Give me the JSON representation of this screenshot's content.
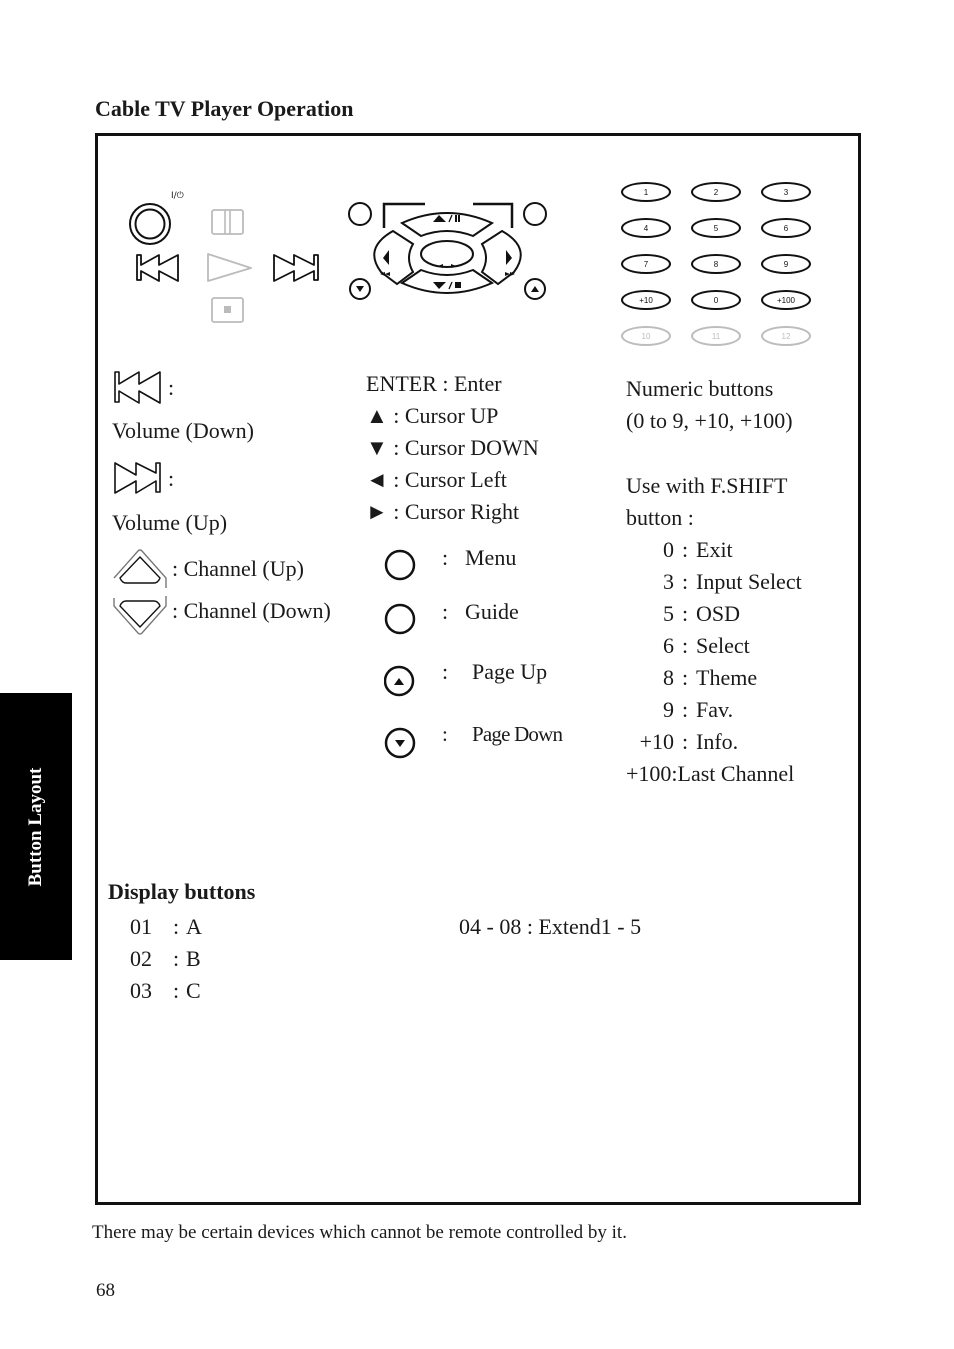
{
  "page": {
    "title": "Cable TV Player Operation",
    "side_tab": "Button Layout",
    "footer_note": "There may be certain devices which cannot be remote controlled by it.",
    "page_number": "68"
  },
  "transport_panel": {
    "power_label": "I/⏻",
    "icons": [
      "power-button",
      "pause-button",
      "skip-back-button",
      "play-button",
      "skip-forward-button",
      "stop-button"
    ]
  },
  "cursor_panel": {
    "up_label": "▲/❚❚",
    "down_label": "▼/■",
    "left_label": "◄◄",
    "right_label": "►►",
    "center_label": "◄ ►"
  },
  "keypad": {
    "rows": [
      [
        {
          "label": "1",
          "dim": false
        },
        {
          "label": "2",
          "dim": false
        },
        {
          "label": "3",
          "dim": false
        }
      ],
      [
        {
          "label": "4",
          "dim": false
        },
        {
          "label": "5",
          "dim": false
        },
        {
          "label": "6",
          "dim": false
        }
      ],
      [
        {
          "label": "7",
          "dim": false
        },
        {
          "label": "8",
          "dim": false
        },
        {
          "label": "9",
          "dim": false
        }
      ],
      [
        {
          "label": "+10",
          "dim": false
        },
        {
          "label": "0",
          "dim": false
        },
        {
          "label": "+100",
          "dim": false
        }
      ],
      [
        {
          "label": "10",
          "dim": true
        },
        {
          "label": "11",
          "dim": true
        },
        {
          "label": "12",
          "dim": true
        }
      ]
    ]
  },
  "legend_left": {
    "skip_back_colon": ":",
    "skip_back_desc": "Volume (Down)",
    "skip_forward_colon": ":",
    "skip_forward_desc": "Volume (Up)",
    "channel_up": ": Channel (Up)",
    "channel_down": ": Channel (Down)"
  },
  "legend_middle": {
    "lines": [
      "ENTER : Enter",
      "▲ : Cursor UP",
      "▼ : Cursor DOWN",
      "◄ : Cursor Left",
      "► : Cursor Right"
    ],
    "buttons": [
      {
        "icon": "circle",
        "colon": ":",
        "label": "Menu"
      },
      {
        "icon": "circle",
        "colon": ":",
        "label": "Guide"
      },
      {
        "icon": "circle-up",
        "colon": ":",
        "label": "Page Up"
      },
      {
        "icon": "circle-down",
        "colon": ":",
        "label": "Page Down"
      }
    ]
  },
  "legend_right": {
    "numeric_title": "Numeric buttons",
    "numeric_range": "(0 to 9, +10, +100)",
    "fshift_intro_1": "Use with F.SHIFT",
    "fshift_intro_2": "button :",
    "fshift": [
      {
        "key": "0",
        "sep": ":",
        "value": "Exit"
      },
      {
        "key": "3",
        "sep": ":",
        "value": "Input Select"
      },
      {
        "key": "5",
        "sep": ":",
        "value": "OSD"
      },
      {
        "key": "6",
        "sep": ":",
        "value": "Select"
      },
      {
        "key": "8",
        "sep": ":",
        "value": "Theme"
      },
      {
        "key": "9",
        "sep": ":",
        "value": "Fav."
      },
      {
        "key": "+10",
        "sep": ":",
        "value": "Info."
      }
    ],
    "last_line": "+100:Last Channel"
  },
  "display_buttons": {
    "heading": "Display buttons",
    "items": [
      {
        "key": "01",
        "sep": ":",
        "value": "A"
      },
      {
        "key": "02",
        "sep": ":",
        "value": "B"
      },
      {
        "key": "03",
        "sep": ":",
        "value": "C"
      }
    ],
    "extend": "04 - 08 : Extend1 - 5"
  }
}
